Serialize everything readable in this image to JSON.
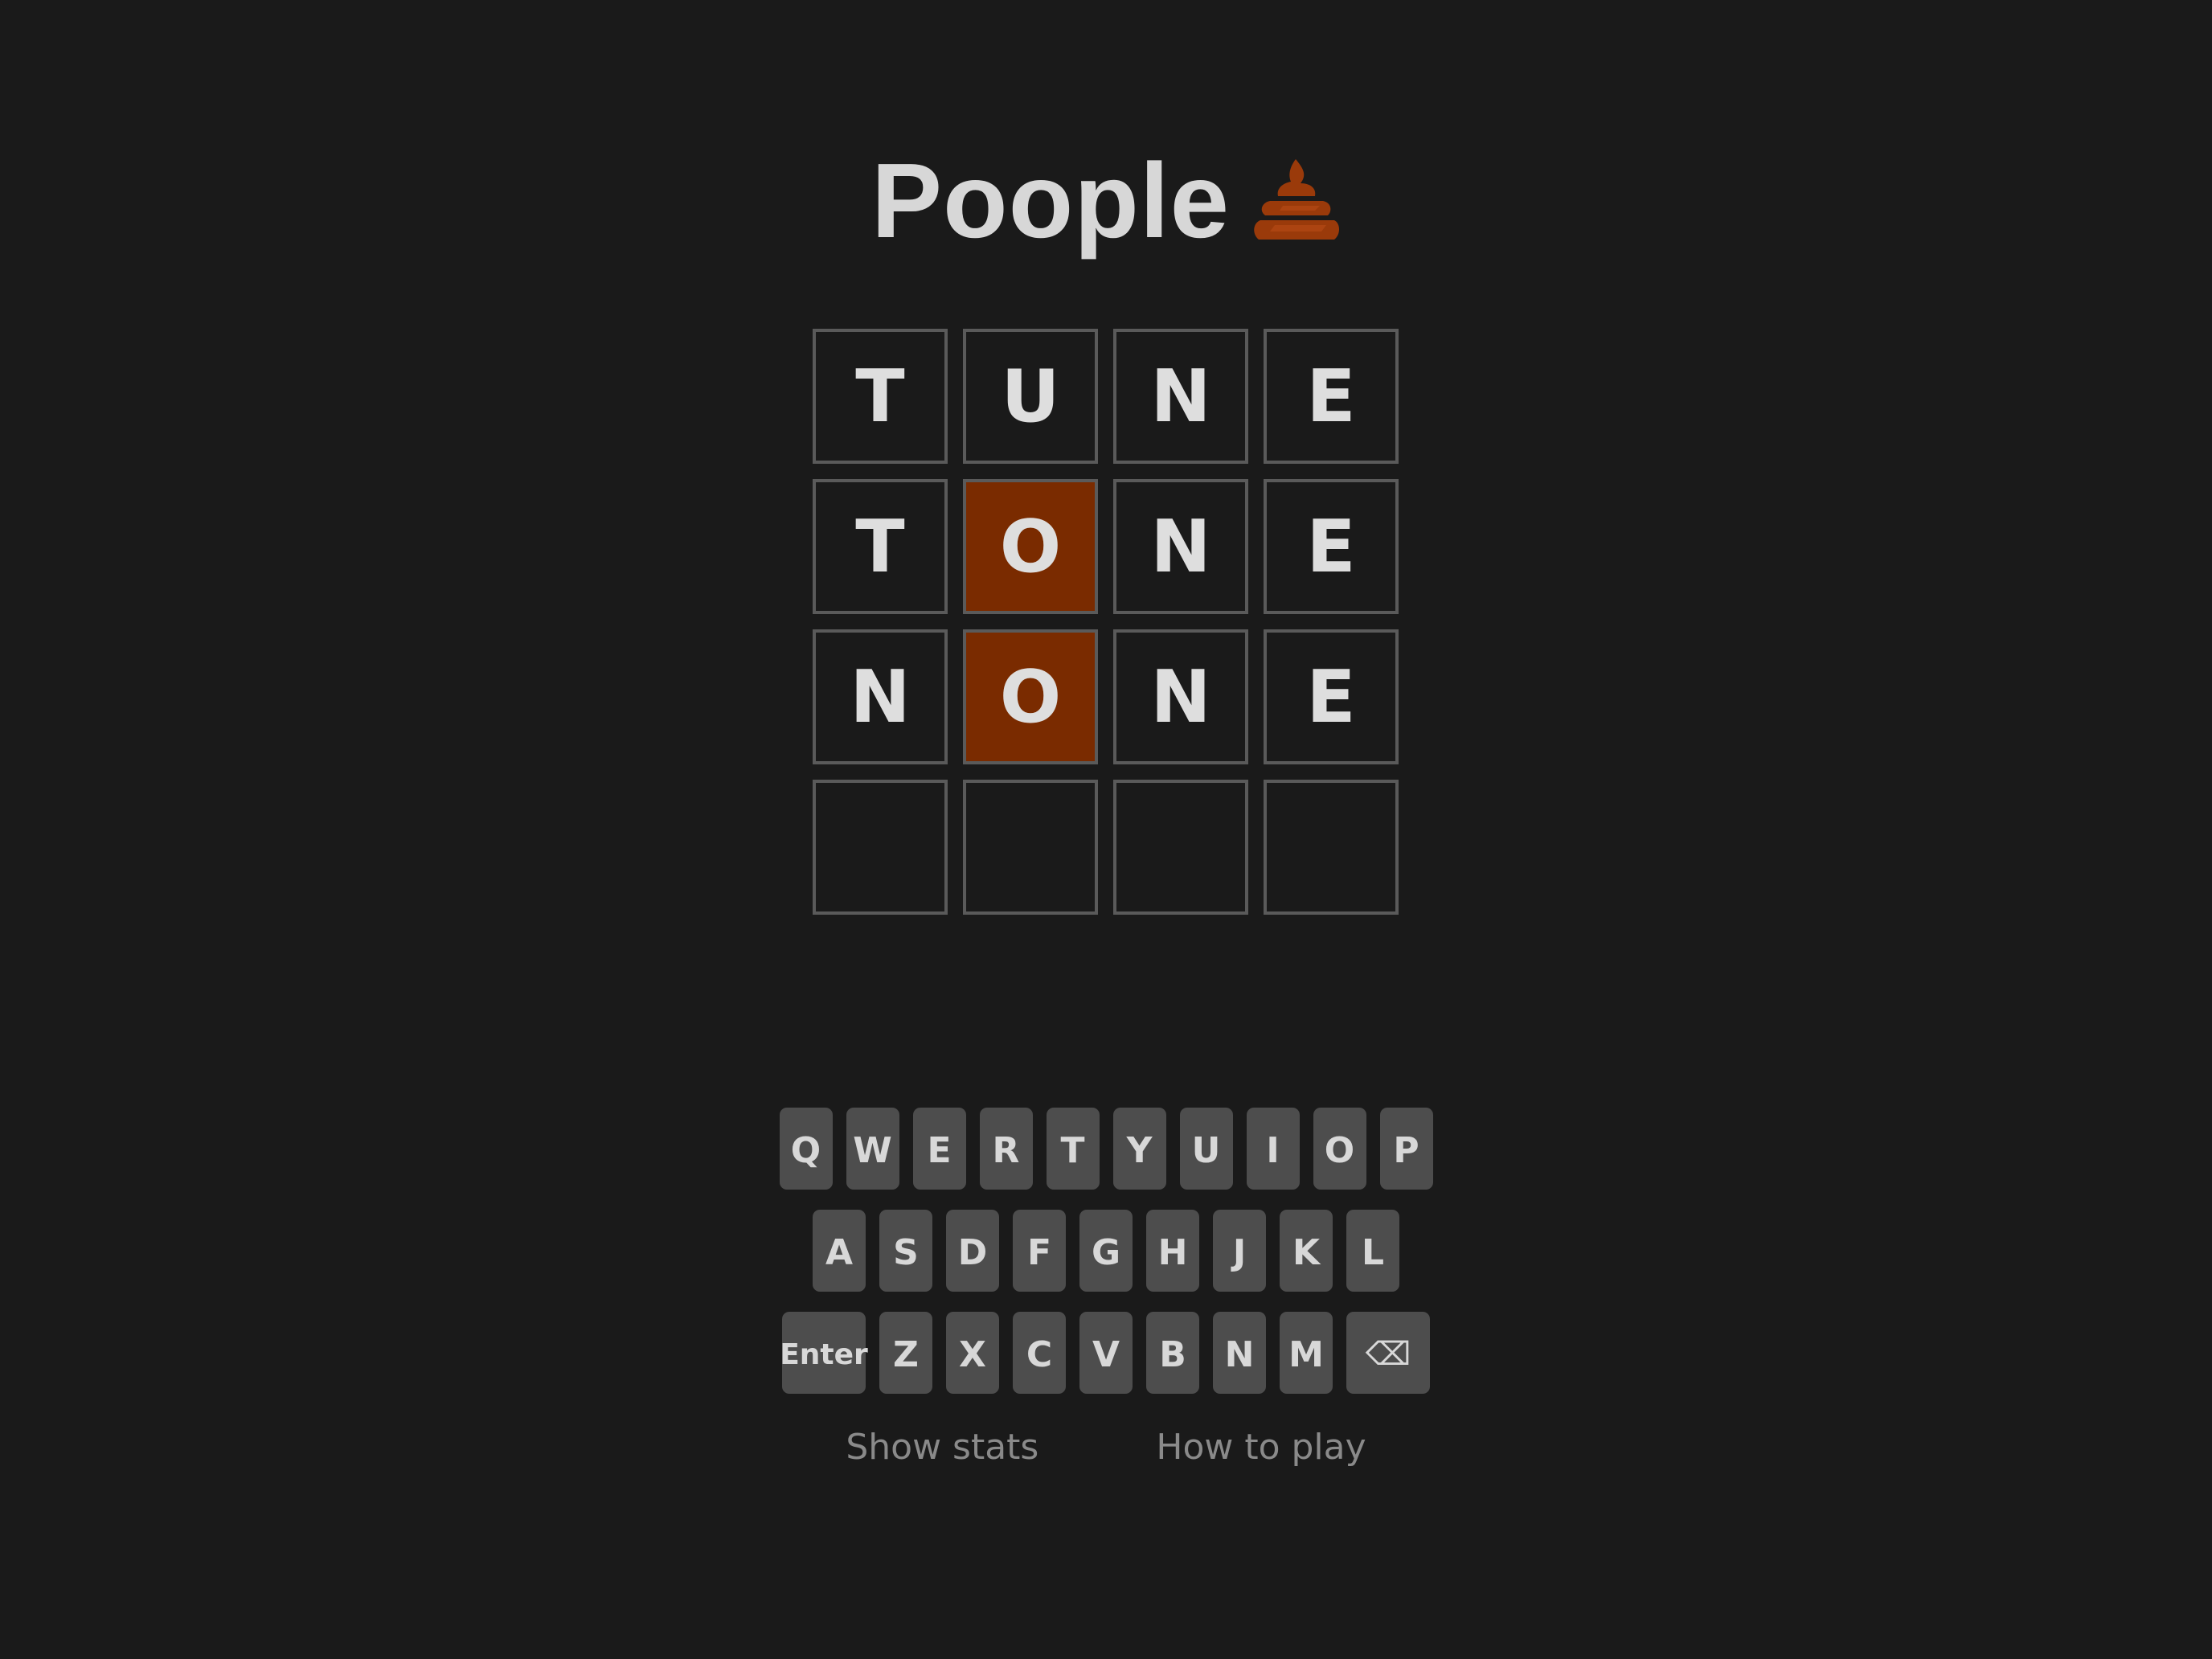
{
  "app": {
    "title": "Poople",
    "title_icon": "poop-icon",
    "accent_color": "#7a2b00"
  },
  "board": {
    "rows": [
      {
        "tiles": [
          {
            "letter": "T",
            "state": "empty"
          },
          {
            "letter": "U",
            "state": "empty"
          },
          {
            "letter": "N",
            "state": "empty"
          },
          {
            "letter": "E",
            "state": "empty"
          }
        ]
      },
      {
        "tiles": [
          {
            "letter": "T",
            "state": "empty"
          },
          {
            "letter": "O",
            "state": "present"
          },
          {
            "letter": "N",
            "state": "empty"
          },
          {
            "letter": "E",
            "state": "empty"
          }
        ]
      },
      {
        "tiles": [
          {
            "letter": "N",
            "state": "empty"
          },
          {
            "letter": "O",
            "state": "present"
          },
          {
            "letter": "N",
            "state": "empty"
          },
          {
            "letter": "E",
            "state": "empty"
          }
        ]
      },
      {
        "tiles": [
          {
            "letter": "",
            "state": "empty"
          },
          {
            "letter": "",
            "state": "empty"
          },
          {
            "letter": "",
            "state": "empty"
          },
          {
            "letter": "",
            "state": "empty"
          }
        ]
      }
    ]
  },
  "keyboard": {
    "rows": [
      [
        "Q",
        "W",
        "E",
        "R",
        "T",
        "Y",
        "U",
        "I",
        "O",
        "P"
      ],
      [
        "A",
        "S",
        "D",
        "F",
        "G",
        "H",
        "J",
        "K",
        "L"
      ],
      [
        "Enter",
        "Z",
        "X",
        "C",
        "V",
        "B",
        "N",
        "M",
        "⌫"
      ]
    ]
  },
  "footer": {
    "show_stats": "Show stats",
    "how_to_play": "How to play"
  }
}
